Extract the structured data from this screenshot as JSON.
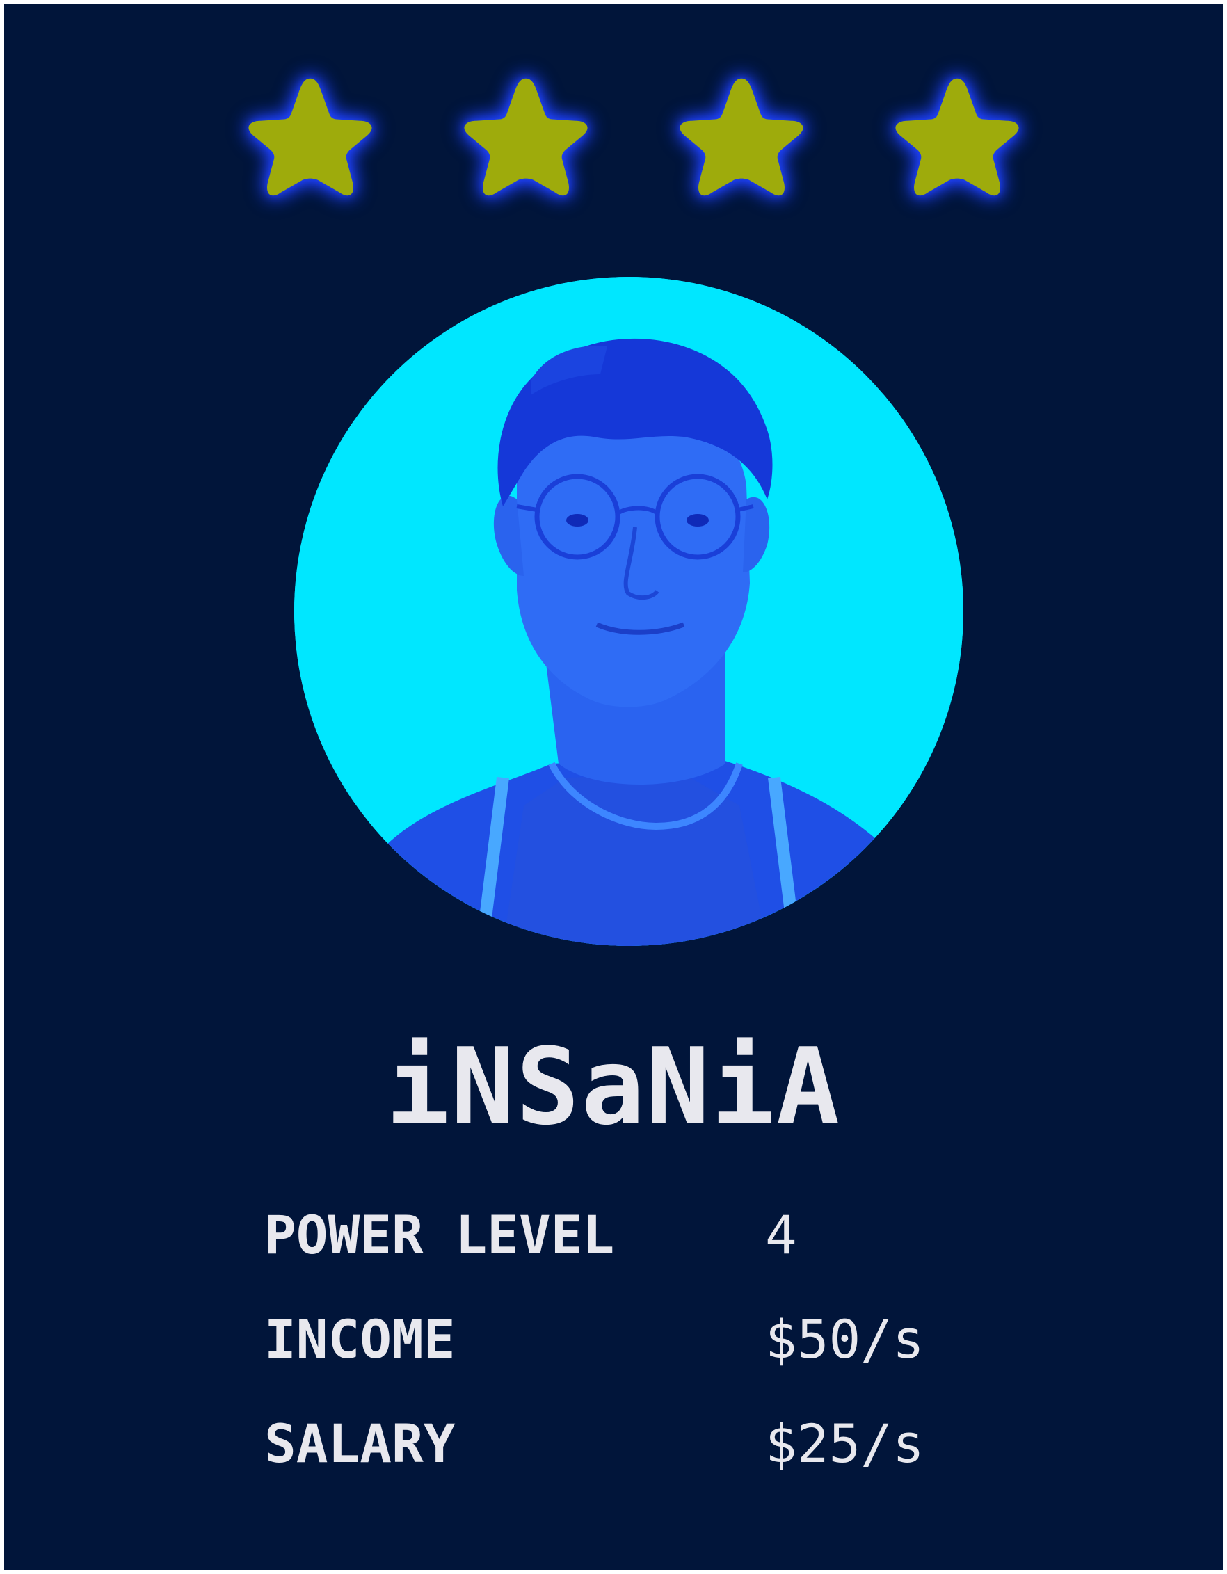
{
  "card": {
    "rating": {
      "stars": 4,
      "star_color": "#9eab0c",
      "glow_color": "#1f46ff",
      "star_icon": "star-icon"
    },
    "portrait": {
      "background_color": "#00e7ff",
      "tint_color": "#1a5cff"
    },
    "player_name": "iNSaNiA",
    "stats": [
      {
        "label": "POWER LEVEL",
        "value": "4"
      },
      {
        "label": "INCOME",
        "value": "$50/s"
      },
      {
        "label": "SALARY",
        "value": "$25/s"
      }
    ],
    "background_color": "#01153a",
    "text_color": "#e8e8ee"
  }
}
